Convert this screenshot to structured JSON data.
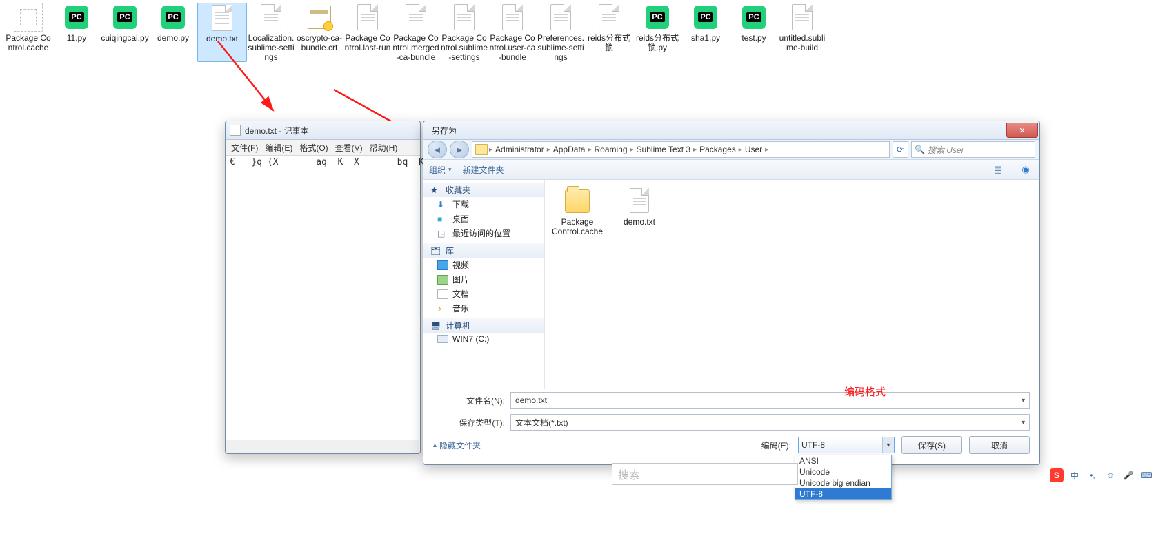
{
  "desktop_files": [
    {
      "name": "Package Control.cache",
      "icon": "cache"
    },
    {
      "name": "11.py",
      "icon": "pc"
    },
    {
      "name": "cuiqingcai.py",
      "icon": "pc"
    },
    {
      "name": "demo.py",
      "icon": "pc"
    },
    {
      "name": "demo.txt",
      "icon": "doc",
      "selected": true
    },
    {
      "name": "Localization.sublime-settings",
      "icon": "doc"
    },
    {
      "name": "oscrypto-ca-bundle.crt",
      "icon": "cert"
    },
    {
      "name": "Package Control.last-run",
      "icon": "doc"
    },
    {
      "name": "Package Control.merged-ca-bundle",
      "icon": "doc"
    },
    {
      "name": "Package Control.sublime-settings",
      "icon": "doc"
    },
    {
      "name": "Package Control.user-ca-bundle",
      "icon": "doc"
    },
    {
      "name": "Preferences.sublime-settings",
      "icon": "doc"
    },
    {
      "name": "reids分布式锁",
      "icon": "doc"
    },
    {
      "name": "reids分布式锁.py",
      "icon": "pc"
    },
    {
      "name": "sha1.py",
      "icon": "pc"
    },
    {
      "name": "test.py",
      "icon": "pc"
    },
    {
      "name": "untitled.sublime-build",
      "icon": "doc"
    }
  ],
  "notepad": {
    "title": "demo.txt - 记事本",
    "menu": [
      "文件(F)",
      "编辑(E)",
      "格式(O)",
      "查看(V)",
      "帮助(H)"
    ],
    "content": "€   }q (X       aq  K  X       bq  K  u."
  },
  "saveas": {
    "title": "另存为",
    "breadcrumb": [
      "Administrator",
      "AppData",
      "Roaming",
      "Sublime Text 3",
      "Packages",
      "User"
    ],
    "search_placeholder": "搜索 User",
    "toolbar": {
      "organize": "组织",
      "newfolder": "新建文件夹"
    },
    "nav": {
      "fav": {
        "head": "收藏夹",
        "items": [
          "下载",
          "桌面",
          "最近访问的位置"
        ]
      },
      "lib": {
        "head": "库",
        "items": [
          "视频",
          "图片",
          "文档",
          "音乐"
        ]
      },
      "comp": {
        "head": "计算机",
        "items": [
          "WIN7 (C:)"
        ]
      }
    },
    "pane_files": [
      {
        "name": "Package Control.cache",
        "icon": "folder"
      },
      {
        "name": "demo.txt",
        "icon": "doc"
      }
    ],
    "filename_label": "文件名(N):",
    "filename_value": "demo.txt",
    "savetype_label": "保存类型(T):",
    "savetype_value": "文本文档(*.txt)",
    "hide_folders": "隐藏文件夹",
    "encoding_label": "编码(E):",
    "encoding_value": "UTF-8",
    "encoding_options": [
      "ANSI",
      "Unicode",
      "Unicode big endian",
      "UTF-8"
    ],
    "save_btn": "保存(S)",
    "cancel_btn": "取消"
  },
  "annotations": {
    "encoding_format": "编码格式"
  },
  "bottom_search_placeholder": "搜索",
  "tray": {
    "ime": "中"
  }
}
